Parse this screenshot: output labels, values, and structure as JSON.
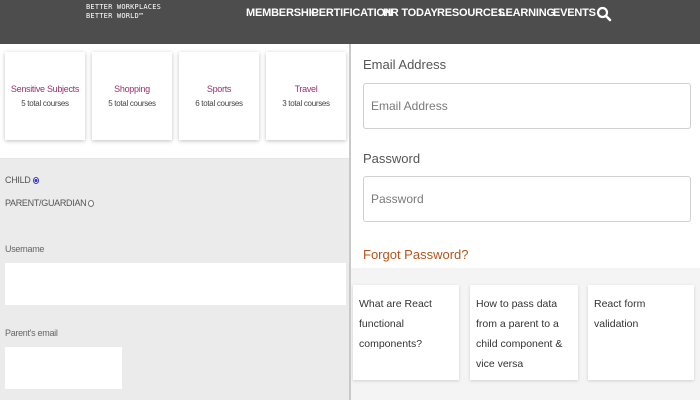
{
  "header": {
    "brand_line1": "BETTER WORKPLACES",
    "brand_line2": "BETTER WORLD™",
    "nav": [
      "MEMBERSHIP",
      "CERTIFICATION",
      "HR TODAY",
      "RESOURCES",
      "LEARNING",
      "EVENTS"
    ],
    "search_icon": "search-icon"
  },
  "categories": [
    {
      "title": "Sensitive Subjects",
      "count": "5 total courses"
    },
    {
      "title": "Shopping",
      "count": "5 total courses"
    },
    {
      "title": "Sports",
      "count": "6 total courses"
    },
    {
      "title": "Travel",
      "count": "3 total courses"
    }
  ],
  "signup_form": {
    "role_options": [
      {
        "label": "CHILD",
        "selected": true
      },
      {
        "label": "PARENT/GUARDIAN",
        "selected": false
      }
    ],
    "username_label": "Username",
    "username_value": "",
    "parent_email_label": "Parent's email",
    "parent_email_value": ""
  },
  "login_form": {
    "email_label": "Email Address",
    "email_placeholder": "Email Address",
    "password_label": "Password",
    "password_placeholder": "Password",
    "forgot_link": "Forgot Password?"
  },
  "faq_cards": [
    "What are React functional components?",
    "How to pass data from a parent to a child component & vice versa",
    "React form validation"
  ],
  "colors": {
    "nav_bg": "#4d4d4d",
    "category_title": "#a0306d",
    "forgot_link": "#b2561d",
    "radio_selected": "#3a3ad0"
  }
}
